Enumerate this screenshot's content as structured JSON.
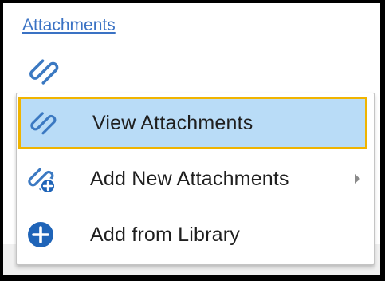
{
  "panel": {
    "attachments_link": "Attachments",
    "icon": "paperclip-icon"
  },
  "menu": {
    "items": [
      {
        "label": "View Attachments",
        "icon": "paperclip-icon",
        "selected": true,
        "has_submenu": false
      },
      {
        "label": "Add New Attachments",
        "icon": "paperclip-add-icon",
        "selected": false,
        "has_submenu": true
      },
      {
        "label": "Add from Library",
        "icon": "plus-circle-icon",
        "selected": false,
        "has_submenu": false
      }
    ]
  },
  "colors": {
    "link": "#3a72c4",
    "icon_blue": "#3b79c2",
    "selected_bg": "#b9dcf7",
    "selected_border": "#f0b400",
    "plus_circle": "#1f64b8"
  }
}
